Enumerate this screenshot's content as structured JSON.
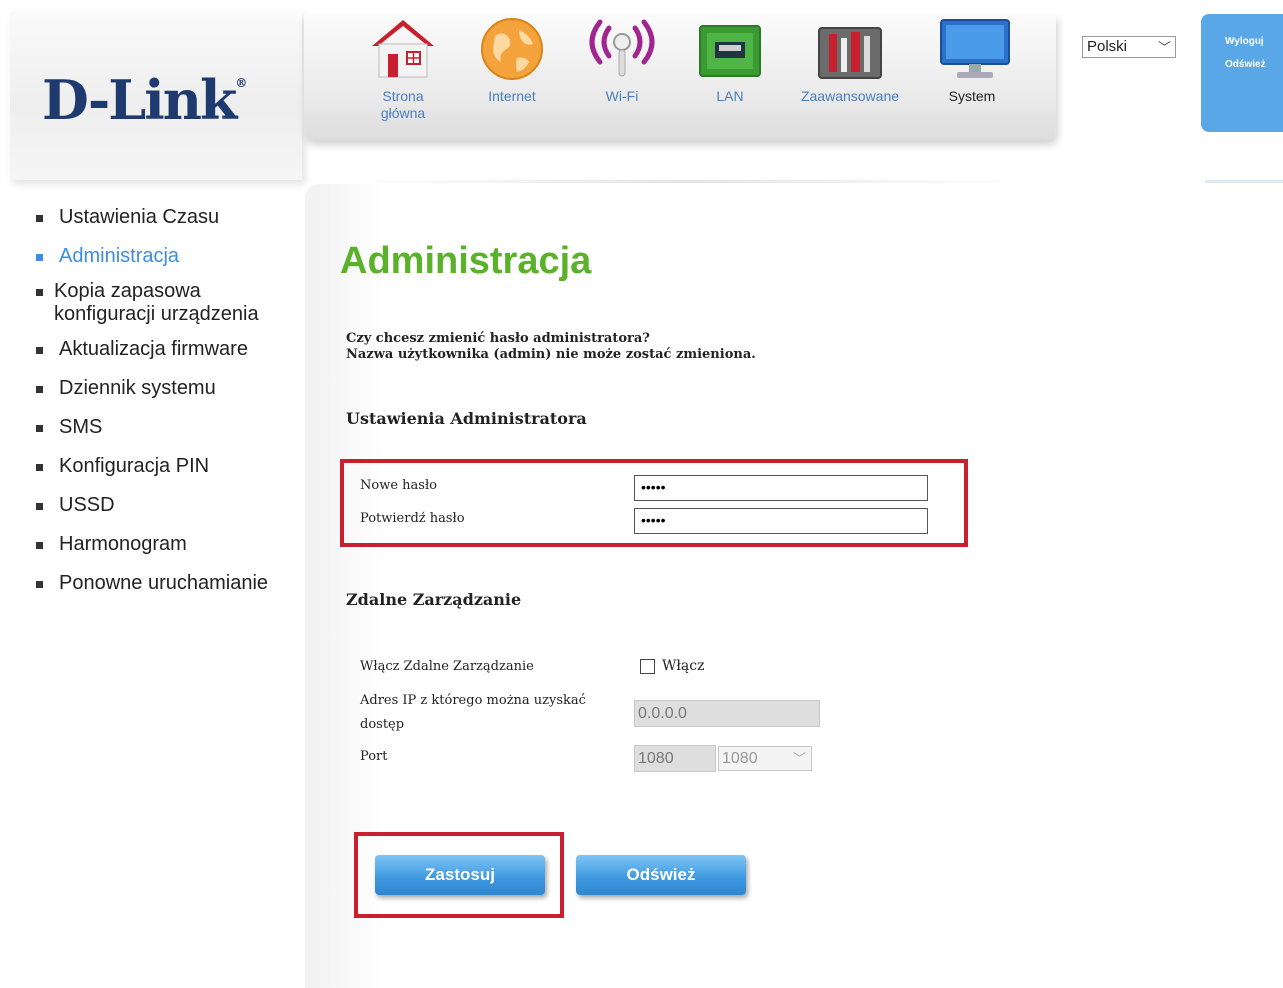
{
  "brand": {
    "logo": "D-Link"
  },
  "nav": {
    "items": [
      {
        "label": "Strona główna",
        "icon": "home-icon"
      },
      {
        "label": "Internet",
        "icon": "globe-icon"
      },
      {
        "label": "Wi-Fi",
        "icon": "wifi-icon"
      },
      {
        "label": "LAN",
        "icon": "lan-port-icon"
      },
      {
        "label": "Zaawansowane",
        "icon": "tools-icon"
      },
      {
        "label": "System",
        "icon": "monitor-icon"
      }
    ],
    "active": "System"
  },
  "language": {
    "selected": "Polski"
  },
  "header_actions": {
    "logout": "Wyloguj",
    "refresh": "Odśwież"
  },
  "sidebar": {
    "items": [
      {
        "label": "Ustawienia Czasu"
      },
      {
        "label": "Administracja"
      },
      {
        "label": "Kopia zapasowa konfiguracji urządzenia"
      },
      {
        "label": "Aktualizacja firmware"
      },
      {
        "label": "Dziennik systemu"
      },
      {
        "label": "SMS"
      },
      {
        "label": "Konfiguracja PIN"
      },
      {
        "label": "USSD"
      },
      {
        "label": "Harmonogram"
      },
      {
        "label": "Ponowne uruchamianie"
      }
    ],
    "active": "Administracja"
  },
  "page": {
    "title": "Administracja",
    "intro_line1": "Czy chcesz zmienić hasło administratora?",
    "intro_line2": "Nazwa użytkownika (admin) nie może zostać zmieniona.",
    "admin_section": "Ustawienia Administratora",
    "new_password_label": "Nowe hasło",
    "new_password_value": "•••••",
    "confirm_password_label": "Potwierdź hasło",
    "confirm_password_value": "•••••",
    "remote_section": "Zdalne Zarządzanie",
    "enable_remote_label": "Włącz Zdalne Zarządzanie",
    "enable_remote_checkbox_label": "Włącz",
    "enable_remote_checked": false,
    "ip_label": "Adres IP z którego można uzyskać dostęp",
    "ip_value": "0.0.0.0",
    "port_label": "Port",
    "port_value": "1080",
    "port_select_value": "1080",
    "apply_button": "Zastosuj",
    "refresh_button": "Odśwież"
  },
  "colors": {
    "title_green": "#59b229",
    "active_blue": "#3d8de0",
    "highlight_red": "#c8202e",
    "button_blue": "#3c97df"
  }
}
